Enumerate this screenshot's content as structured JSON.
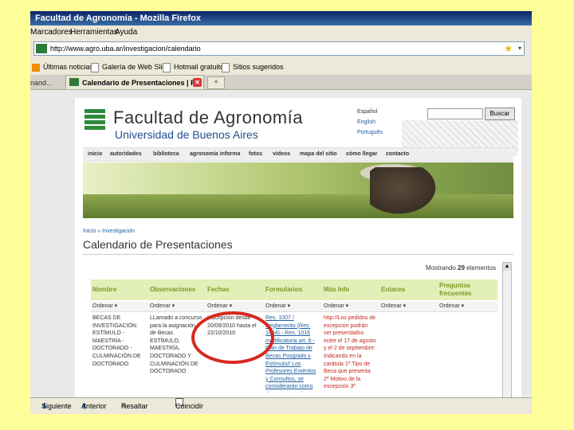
{
  "window": {
    "title": "Facultad de Agronomía - Mozilla Firefox"
  },
  "menu": {
    "items": [
      "Marcadores",
      "Herramientas",
      "Ayuda"
    ]
  },
  "address": {
    "url": "http://www.agro.uba.ar/investigacion/calendario"
  },
  "bookmarks": [
    "Últimas noticias",
    "Galería de Web Slice",
    "Hotmail gratuito",
    "Sitios sugeridos"
  ],
  "tabs": {
    "first": "nand...",
    "active": "Calendario de Presentaciones | F..."
  },
  "site": {
    "brand_title": "Facultad de Agronomía",
    "brand_subtitle": "Universidad de Buenos Aires",
    "languages": [
      "Español",
      "English",
      "Português"
    ],
    "search_button": "Buscar",
    "nav": [
      "inicio",
      "autoridades",
      "biblioteca",
      "agronomía informa",
      "fotos",
      "videos",
      "mapa del sitio",
      "cómo llegar",
      "contacto"
    ],
    "breadcrumb": "Inicio » Investigación",
    "page_title": "Calendario de Presentaciones",
    "count_prefix": "Mostrando",
    "count_value": "29",
    "count_suffix": "elementos"
  },
  "table": {
    "headers": [
      "Nombre",
      "Observaciones",
      "Fechas",
      "Formularios",
      "Más Info",
      "Enlaces",
      "Preguntas frecuentes"
    ],
    "sort_label": "Ordenar ▾",
    "row": {
      "nombre": "BECAS DE INVESTIGACIÓN: ESTÍMULO - MAESTRÍA - DOCTORADO - CULMINACIÓN DE DOCTORADO",
      "observaciones": "LLamado a concurso para la asignación de Becas ESTÍMULO, MAESTRÍA, DOCTORADO Y CULMINACIÓN DE DOCTORADO",
      "fechas": "Inscripción desde 20/09/2010 hasta el 22/10/2010",
      "formularios": "Res. 1007 / Reglamento (Res. 1034) - Res. 1016 modificatoria art. 6 - Plan de Trabajo de Becas Posgrado y Estímulo// Los Profesores Eméritos y Consultos, se considerarán como docentes regulares,",
      "masinfo": "http://Los pedidos de excepción podrán ser presentados entre el 17 de agosto y el 2 de septiembre: Indicando en la carátula 1º Tipo de Beca que presenta 2º Motivo de la excepción 3º"
    }
  },
  "findbar": {
    "next": "Siguiente",
    "prev": "Anterior",
    "highlight": "Resaltar todo",
    "match_case": "Coincidir mayúsculas"
  },
  "colors": {
    "accent_green": "#7a9a22",
    "header_bg": "#e2efb8",
    "annotation_red": "#d8281e"
  }
}
